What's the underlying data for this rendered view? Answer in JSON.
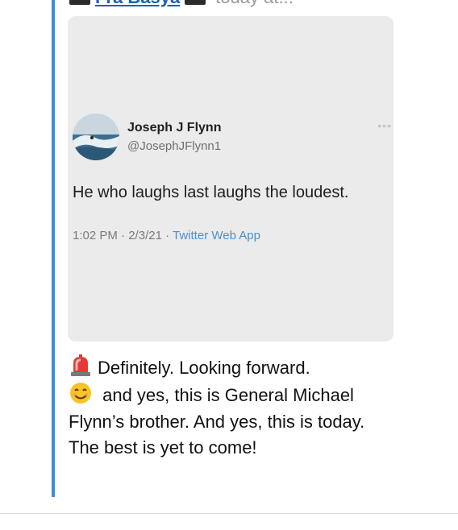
{
  "header": {
    "author_display": "Fra Basya",
    "timestamp": "today at..."
  },
  "quoted_tweet": {
    "author_name": "Joseph J Flynn",
    "author_handle": "@JosephJFlynn1",
    "more_icon": "more-dots-icon",
    "text": "He who laughs last laughs the loudest.",
    "time": "1:02 PM",
    "date": "2/3/21",
    "separator": "·",
    "source": "Twitter Web App"
  },
  "comment": {
    "line1_text": "Definitely. Looking forward.",
    "line1_icon": "rotating-light-emoji",
    "line2_icon": "smiling-face-emoji",
    "line2_text": " and yes, this is General",
    "line3_text": "Michael Flynn’s brother. And yes, this is today. The best is yet to come!"
  },
  "colors": {
    "thread_line": "#3a8fd0",
    "card_bg": "#ebebeb",
    "link": "#4a90c8"
  }
}
